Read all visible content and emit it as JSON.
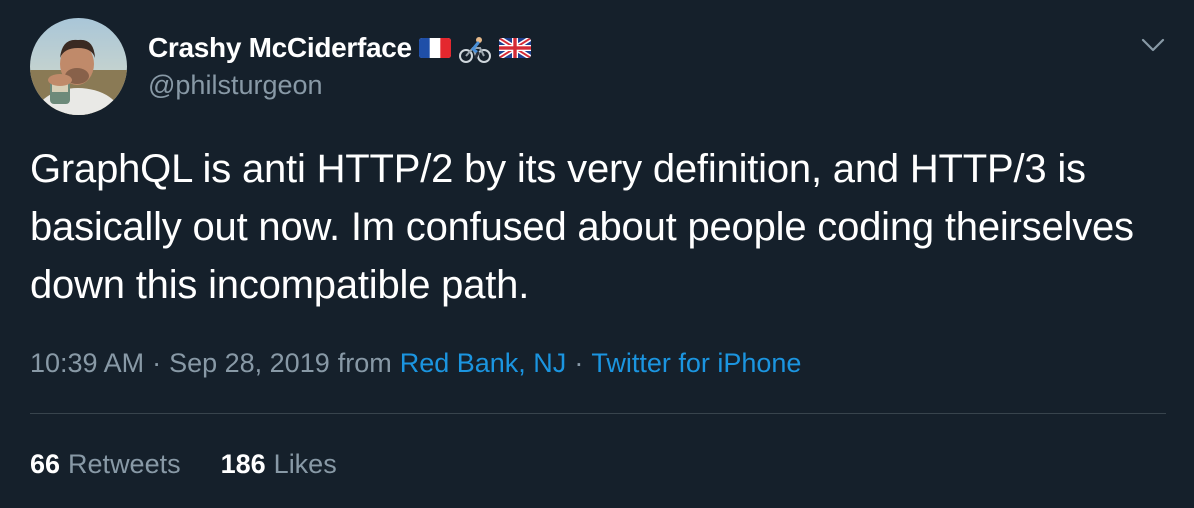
{
  "user": {
    "display_name": "Crashy McCiderface",
    "handle": "@philsturgeon",
    "name_emojis": [
      "flag-france-icon",
      "cyclist-icon",
      "flag-uk-icon"
    ]
  },
  "tweet": {
    "text": "GraphQL is anti HTTP/2 by its very definition, and HTTP/3 is basically out now. Im confused about people coding theirselves down this incompatible path."
  },
  "meta": {
    "time": "10:39 AM",
    "separator": "·",
    "date": "Sep 28, 2019",
    "from_label": "from",
    "location": "Red Bank, NJ",
    "source": "Twitter for iPhone"
  },
  "stats": {
    "retweets_count": "66",
    "retweets_label": "Retweets",
    "likes_count": "186",
    "likes_label": "Likes"
  },
  "colors": {
    "background": "#15202b",
    "text_primary": "#ffffff",
    "text_secondary": "#8899a6",
    "link": "#1b95e0",
    "divider": "#38444d"
  }
}
